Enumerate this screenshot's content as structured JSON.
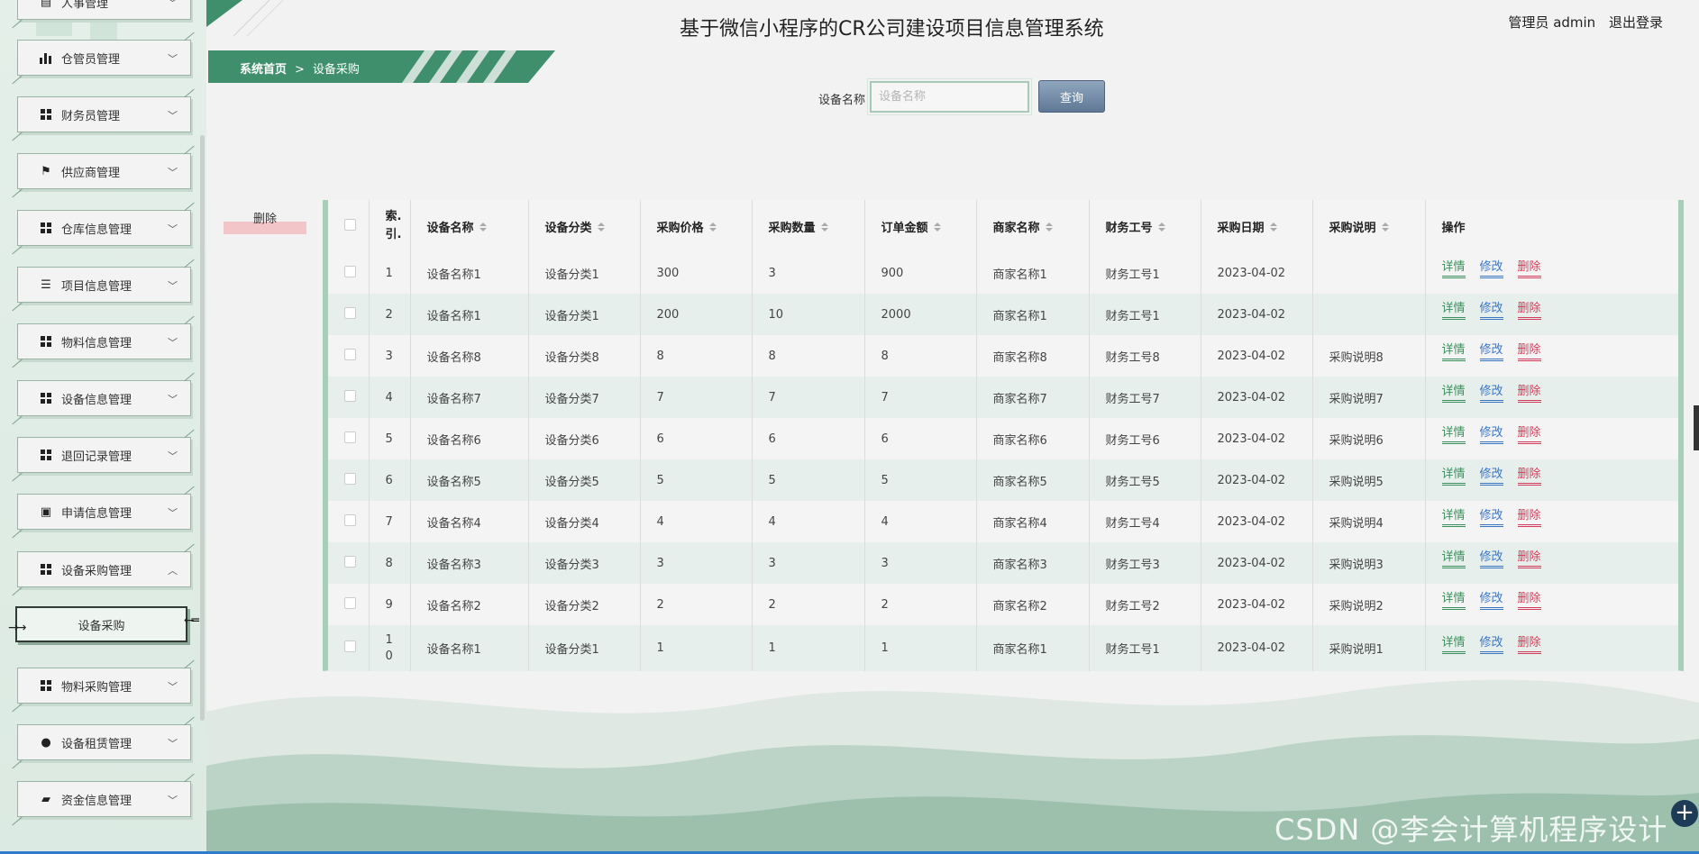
{
  "header": {
    "title": "基于微信小程序的CR公司建设项目信息管理系统",
    "user_label": "管理员 admin",
    "logout_label": "退出登录"
  },
  "breadcrumb": {
    "home": "系统首页",
    "separator": ">",
    "current": "设备采购"
  },
  "sidebar": {
    "items": [
      {
        "label": "人事管理",
        "icon": "user-card-icon"
      },
      {
        "label": "仓管员管理",
        "icon": "bar-chart-icon"
      },
      {
        "label": "财务员管理",
        "icon": "grid-icon"
      },
      {
        "label": "供应商管理",
        "icon": "flag-icon"
      },
      {
        "label": "仓库信息管理",
        "icon": "grid-icon"
      },
      {
        "label": "项目信息管理",
        "icon": "list-icon"
      },
      {
        "label": "物料信息管理",
        "icon": "grid-icon"
      },
      {
        "label": "设备信息管理",
        "icon": "grid-icon"
      },
      {
        "label": "退回记录管理",
        "icon": "grid-icon"
      },
      {
        "label": "申请信息管理",
        "icon": "briefcase-icon"
      },
      {
        "label": "设备采购管理",
        "icon": "grid-icon"
      },
      {
        "label": "物料采购管理",
        "icon": "grid-icon"
      },
      {
        "label": "设备租赁管理",
        "icon": "bulb-icon"
      },
      {
        "label": "资金信息管理",
        "icon": "ticket-icon"
      }
    ],
    "active_sub": "设备采购"
  },
  "search": {
    "label": "设备名称",
    "placeholder": "设备名称",
    "button": "查询"
  },
  "batch_delete_label": "删除",
  "table": {
    "columns": [
      "索引",
      "设备名称",
      "设备分类",
      "采购价格",
      "采购数量",
      "订单金额",
      "商家名称",
      "财务工号",
      "采购日期",
      "采购说明",
      "操作"
    ],
    "index_header_line1": "索.",
    "index_header_line2": "引.",
    "actions": {
      "detail": "详情",
      "edit": "修改",
      "delete": "删除"
    },
    "rows": [
      {
        "idx": "1",
        "name": "设备名称1",
        "cat": "设备分类1",
        "price": "300",
        "qty": "3",
        "amount": "900",
        "vendor": "商家名称1",
        "fin": "财务工号1",
        "date": "2023-04-02",
        "note": ""
      },
      {
        "idx": "2",
        "name": "设备名称1",
        "cat": "设备分类1",
        "price": "200",
        "qty": "10",
        "amount": "2000",
        "vendor": "商家名称1",
        "fin": "财务工号1",
        "date": "2023-04-02",
        "note": ""
      },
      {
        "idx": "3",
        "name": "设备名称8",
        "cat": "设备分类8",
        "price": "8",
        "qty": "8",
        "amount": "8",
        "vendor": "商家名称8",
        "fin": "财务工号8",
        "date": "2023-04-02",
        "note": "采购说明8"
      },
      {
        "idx": "4",
        "name": "设备名称7",
        "cat": "设备分类7",
        "price": "7",
        "qty": "7",
        "amount": "7",
        "vendor": "商家名称7",
        "fin": "财务工号7",
        "date": "2023-04-02",
        "note": "采购说明7"
      },
      {
        "idx": "5",
        "name": "设备名称6",
        "cat": "设备分类6",
        "price": "6",
        "qty": "6",
        "amount": "6",
        "vendor": "商家名称6",
        "fin": "财务工号6",
        "date": "2023-04-02",
        "note": "采购说明6"
      },
      {
        "idx": "6",
        "name": "设备名称5",
        "cat": "设备分类5",
        "price": "5",
        "qty": "5",
        "amount": "5",
        "vendor": "商家名称5",
        "fin": "财务工号5",
        "date": "2023-04-02",
        "note": "采购说明5"
      },
      {
        "idx": "7",
        "name": "设备名称4",
        "cat": "设备分类4",
        "price": "4",
        "qty": "4",
        "amount": "4",
        "vendor": "商家名称4",
        "fin": "财务工号4",
        "date": "2023-04-02",
        "note": "采购说明4"
      },
      {
        "idx": "8",
        "name": "设备名称3",
        "cat": "设备分类3",
        "price": "3",
        "qty": "3",
        "amount": "3",
        "vendor": "商家名称3",
        "fin": "财务工号3",
        "date": "2023-04-02",
        "note": "采购说明3"
      },
      {
        "idx": "9",
        "name": "设备名称2",
        "cat": "设备分类2",
        "price": "2",
        "qty": "2",
        "amount": "2",
        "vendor": "商家名称2",
        "fin": "财务工号2",
        "date": "2023-04-02",
        "note": "采购说明2"
      },
      {
        "idx": "10",
        "name": "设备名称1",
        "cat": "设备分类1",
        "price": "1",
        "qty": "1",
        "amount": "1",
        "vendor": "商家名称1",
        "fin": "财务工号1",
        "date": "2023-04-02",
        "note": "采购说明1"
      }
    ]
  },
  "watermark": "CSDN @李会计算机程序设计",
  "colors": {
    "accent_green": "#3a8f6a",
    "detail": "#3b8f5d",
    "edit": "#3a75c4",
    "delete": "#d23c5a",
    "search_button": "#6f86a3"
  }
}
